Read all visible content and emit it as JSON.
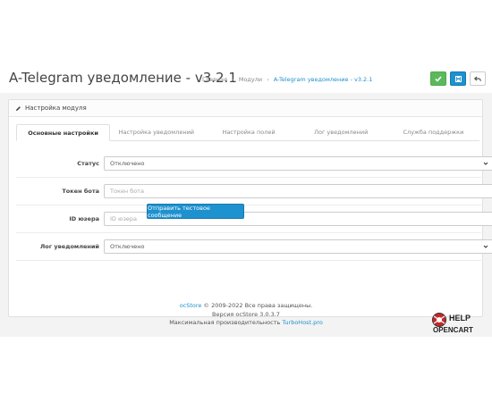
{
  "header": {
    "title": "A-Telegram уведомление - v3.2.1",
    "breadcrumb": [
      "Главная",
      "Модули",
      "A-Telegram уведомление - v3.2.1"
    ]
  },
  "actions": {
    "save_icon": "check-icon",
    "save_disk_icon": "floppy-icon",
    "back_icon": "reply-icon"
  },
  "panel": {
    "heading": "Настройка модуля",
    "heading_icon": "pencil-icon"
  },
  "tabs": [
    {
      "label": "Основные настройки",
      "active": true
    },
    {
      "label": "Настройка уведомлений",
      "active": false
    },
    {
      "label": "Настройка полей",
      "active": false
    },
    {
      "label": "Лог уведомлений",
      "active": false
    },
    {
      "label": "Служба поддержки",
      "active": false
    }
  ],
  "form": {
    "status": {
      "label": "Статус",
      "value": "Отключено"
    },
    "token": {
      "label": "Токен бота",
      "placeholder": "Токен бота",
      "value": ""
    },
    "user_id": {
      "label": "ID юзера",
      "placeholder": "ID юзера",
      "value": ""
    },
    "log": {
      "label": "Лог уведомлений",
      "value": "Отключено"
    },
    "send_button": "Отправить тестовое сообщение"
  },
  "footer": {
    "line1_link": "ocStore",
    "line1_text": "© 2009-2022 Все права защищены.",
    "line2": "Версия ocStore 3.0.3.7",
    "line3_text": "Максимальная производительность",
    "line3_link": "TurboHost.pro"
  },
  "logo": {
    "line1": "HELP",
    "line2": "OPENCART"
  },
  "colors": {
    "primary": "#1e91cf",
    "success": "#5cb85c",
    "background": "#f3f3f3"
  }
}
